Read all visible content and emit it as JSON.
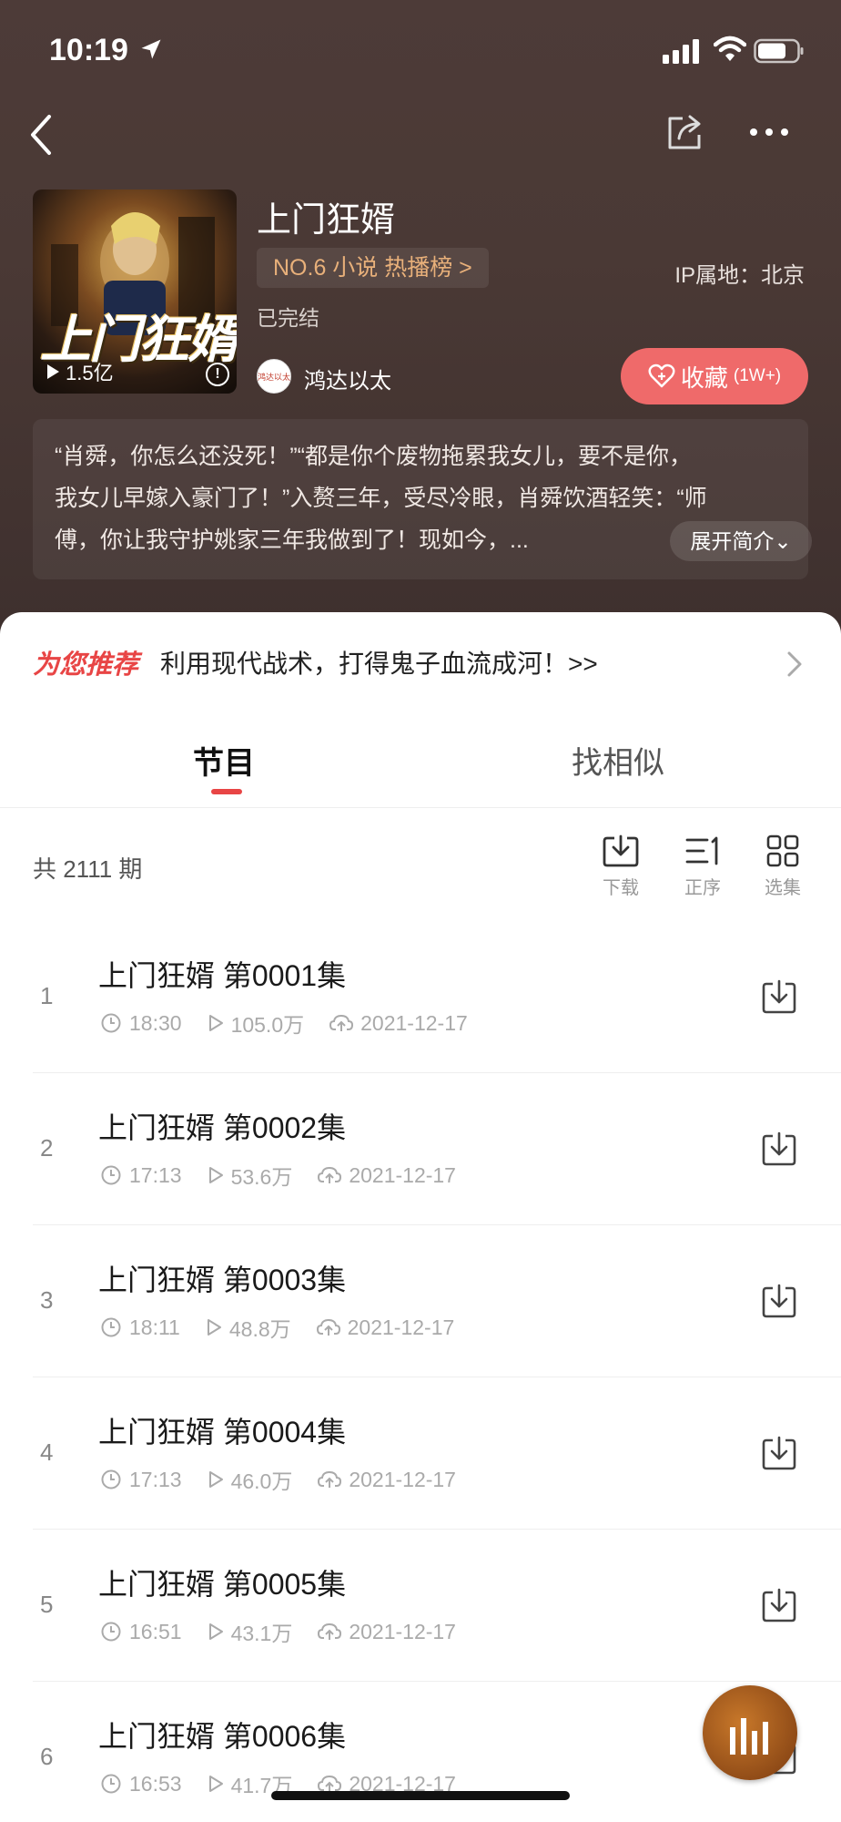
{
  "status": {
    "time": "10:19"
  },
  "book": {
    "title": "上门狂婿",
    "rank": "NO.6 小说 热播榜 >",
    "ip": "IP属地：北京",
    "status": "已完结",
    "author": "鸿达以太",
    "author_avatar_text": "鸿达以太",
    "cover_title": "上门狂婿",
    "plays": "1.5亿",
    "favorite_label": "收藏",
    "favorite_count": "(1W+)",
    "intro_line1": "“肖舜，你怎么还没死！”“都是你个废物拖累我女儿，要不是你，",
    "intro_line2": "我女儿早嫁入豪门了！”入赘三年，受尽冷眼，肖舜饮酒轻笑：“师",
    "intro_line3": "傅，你让我守护姚家三年我做到了！现如今，...",
    "expand_label": "展开简介⌄"
  },
  "recommend": {
    "tag": "为您推荐",
    "text": "利用现代战术，打得鬼子血流成河！>>"
  },
  "tabs": {
    "programs": "节目",
    "similar": "找相似"
  },
  "list": {
    "count": "共 2111 期",
    "download": "下载",
    "order": "正序",
    "select": "选集",
    "episodes": [
      {
        "num": "1",
        "title": "上门狂婿 第0001集",
        "duration": "18:30",
        "plays": "105.0万",
        "date": "2021-12-17"
      },
      {
        "num": "2",
        "title": "上门狂婿 第0002集",
        "duration": "17:13",
        "plays": "53.6万",
        "date": "2021-12-17"
      },
      {
        "num": "3",
        "title": "上门狂婿 第0003集",
        "duration": "18:11",
        "plays": "48.8万",
        "date": "2021-12-17"
      },
      {
        "num": "4",
        "title": "上门狂婿 第0004集",
        "duration": "17:13",
        "plays": "46.0万",
        "date": "2021-12-17"
      },
      {
        "num": "5",
        "title": "上门狂婿 第0005集",
        "duration": "16:51",
        "plays": "43.1万",
        "date": "2021-12-17"
      },
      {
        "num": "6",
        "title": "上门狂婿 第0006集",
        "duration": "16:53",
        "plays": "41.7万",
        "date": "2021-12-17"
      }
    ]
  },
  "colors": {
    "accent": "#e84545",
    "favorite_bg": "#ef6a6a",
    "rank_text": "#e8b07a",
    "header_bg": "#4a3935"
  }
}
